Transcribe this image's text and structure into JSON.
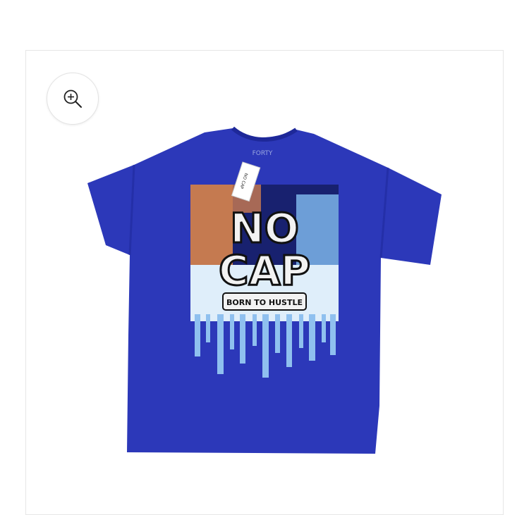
{
  "gallery": {
    "zoom_icon": "zoom-in-icon",
    "product_image": {
      "shirt_color": "#2a36b8",
      "print": {
        "main_text_line1": "NO",
        "main_text_line2": "CAP",
        "tagline": "BORN TO HUSTLE",
        "collar_label": "FORTY",
        "tag_text": "NO CAP"
      }
    }
  }
}
